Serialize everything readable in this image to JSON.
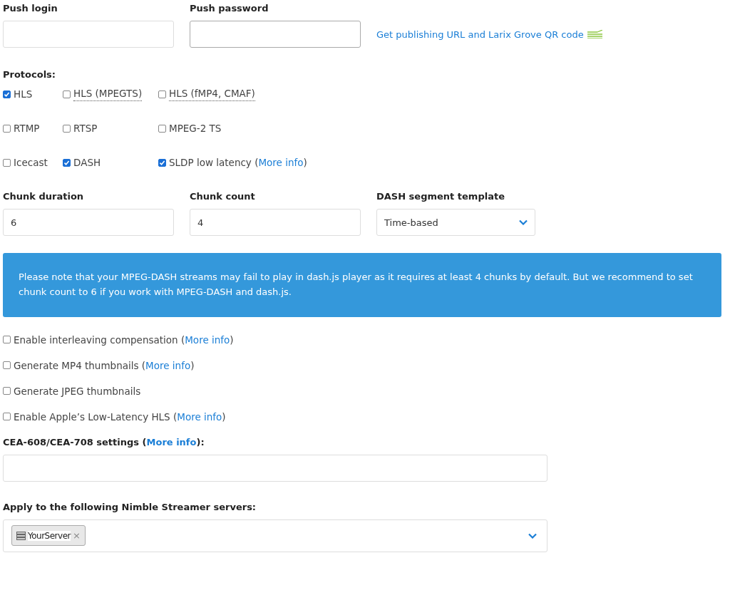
{
  "credentials": {
    "login": {
      "label": "Push login"
    },
    "password": {
      "label": "Push password"
    },
    "link": "Get publishing URL and Larix Grove QR code"
  },
  "protocols": {
    "label": "Protocols:",
    "items": [
      {
        "label": "HLS",
        "checked": true,
        "dotted_underline": false
      },
      {
        "label": "HLS (MPEGTS)",
        "checked": false,
        "dotted_underline": true
      },
      {
        "label": "HLS (fMP4, CMAF)",
        "checked": false,
        "dotted_underline": true
      },
      {
        "label": "RTMP",
        "checked": false,
        "dotted_underline": false
      },
      {
        "label": "RTSP",
        "checked": false,
        "dotted_underline": false
      },
      {
        "label": "MPEG-2 TS",
        "checked": false,
        "dotted_underline": false
      },
      {
        "label": "Icecast",
        "checked": false,
        "dotted_underline": false
      },
      {
        "label": "DASH",
        "checked": true,
        "dotted_underline": false
      },
      {
        "label": "SLDP low latency (",
        "link": "More info",
        "after": ")",
        "checked": true,
        "dotted_underline": false
      }
    ]
  },
  "chunks": {
    "duration": {
      "label": "Chunk duration",
      "value": "6"
    },
    "count": {
      "label": "Chunk count",
      "value": "4"
    },
    "template": {
      "label": "DASH segment template",
      "value": "Time-based"
    }
  },
  "notice": "Please note that your MPEG-DASH streams may fail to play in dash.js player as it requires at least 4 chunks by default. But we recommend to set chunk count to 6 if you work with MPEG-DASH and dash.js.",
  "options": [
    {
      "label": "Enable interleaving compensation (",
      "link": "More info",
      "after": ")",
      "checked": false
    },
    {
      "label": "Generate MP4 thumbnails (",
      "link": "More info",
      "after": ")",
      "checked": false
    },
    {
      "label": "Generate JPEG thumbnails",
      "checked": false
    },
    {
      "label": "Enable Apple’s Low-Latency HLS (",
      "link": "More info",
      "after": ")",
      "checked": false
    }
  ],
  "cea": {
    "label": "CEA-608/CEA-708 settings (",
    "link": "More info",
    "after": "):"
  },
  "servers": {
    "label": "Apply to the following Nimble Streamer servers:",
    "tags": [
      "YourServer"
    ],
    "remove": "×"
  }
}
